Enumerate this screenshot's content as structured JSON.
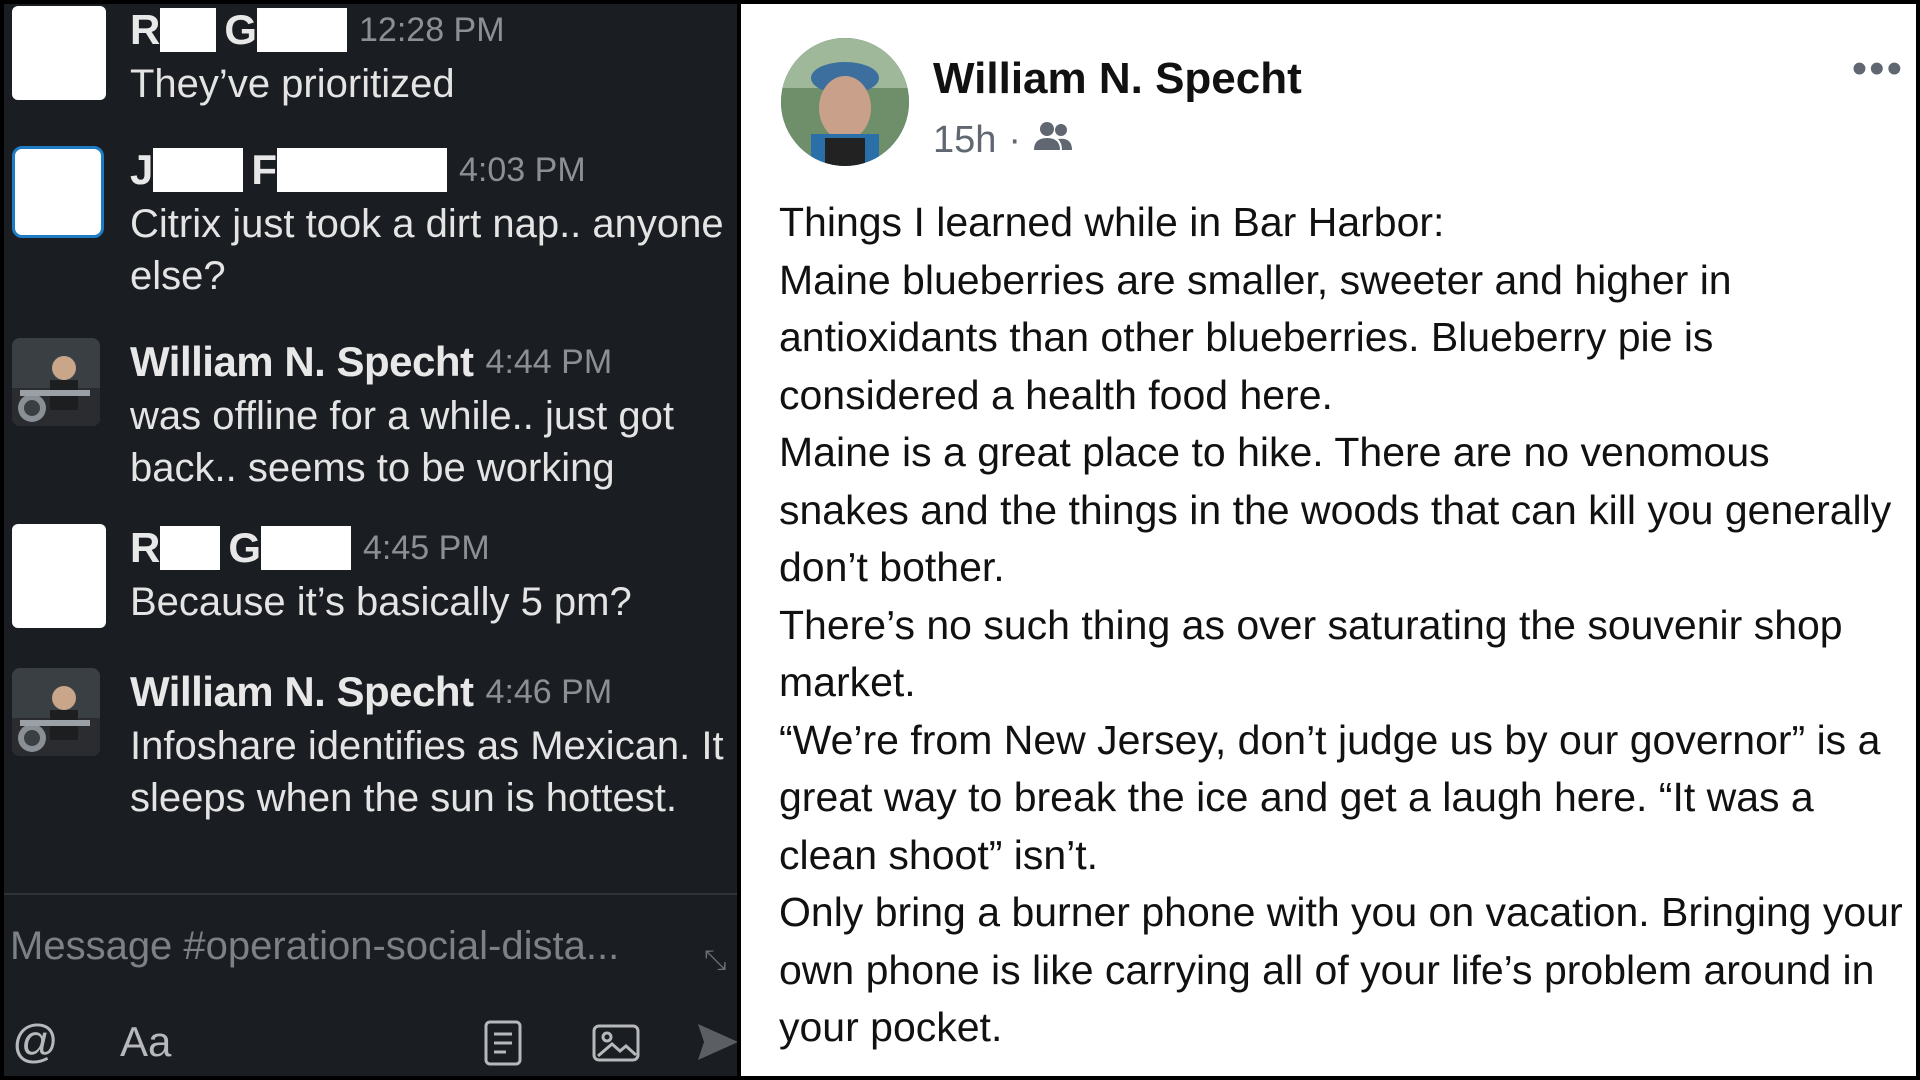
{
  "chat": {
    "messages": [
      {
        "initial1": "R",
        "initial2": "G",
        "time": "12:28 PM",
        "text": "They’ve prioritized"
      },
      {
        "initial1": "J",
        "initial2": "F",
        "time": "4:03 PM",
        "text": "Citrix just took a dirt nap.. anyone else?"
      },
      {
        "name": "William N. Specht",
        "time": "4:44 PM",
        "text": "was offline for a while.. just got back.. seems to be working"
      },
      {
        "initial1": "R",
        "initial2": "G",
        "time": "4:45 PM",
        "text": "Because it’s basically 5 pm?"
      },
      {
        "name": "William N. Specht",
        "time": "4:46 PM",
        "text": "Infoshare identifies as Mexican. It sleeps when the sun is hottest."
      }
    ],
    "composer": {
      "placeholder": "Message #operation-social-dista...",
      "at_label": "@",
      "format_label": "Aa"
    },
    "icons": [
      "expand-icon",
      "at-icon",
      "format-text-icon",
      "shortcut-icon",
      "image-icon",
      "send-icon"
    ]
  },
  "post": {
    "author": "William N. Specht",
    "age": "15h",
    "separator": "·",
    "more_label": "•••",
    "icons": [
      "friends-audience-icon",
      "more-options-icon"
    ],
    "paragraphs": [
      "Things I learned while in Bar Harbor:",
      "Maine blueberries are smaller, sweeter and higher in antioxidants than other blueberries. Blueberry pie is considered a health food here.",
      "Maine is a great place to hike. There are no venomous snakes and the things in the woods that can kill you generally don’t bother.",
      "There’s no such thing as over saturating the souvenir shop market.",
      "“We’re from New Jersey, don’t judge us by our governor” is a great way to break the ice and get a laugh here. “It was a clean shoot” isn’t.",
      "Only bring a burner phone with you on vacation. Bringing your own phone is like carrying all of your life’s problem around in your pocket."
    ]
  },
  "colors": {
    "chat_bg": "#1a1d21",
    "chat_text": "#e4e4e4",
    "chat_muted": "#8c8f94",
    "post_bg": "#ffffff",
    "post_text": "#111111",
    "post_muted": "#606770"
  }
}
